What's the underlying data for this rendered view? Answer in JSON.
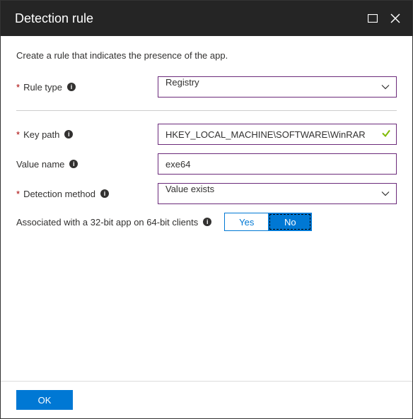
{
  "header": {
    "title": "Detection rule"
  },
  "description": "Create a rule that indicates the presence of the app.",
  "fields": {
    "ruleType": {
      "label": "Rule type",
      "value": "Registry"
    },
    "keyPath": {
      "label": "Key path",
      "value": "HKEY_LOCAL_MACHINE\\SOFTWARE\\WinRAR"
    },
    "valueName": {
      "label": "Value name",
      "value": "exe64"
    },
    "detectionMethod": {
      "label": "Detection method",
      "value": "Value exists"
    }
  },
  "toggle": {
    "label": "Associated with a 32-bit app on 64-bit clients",
    "yes": "Yes",
    "no": "No"
  },
  "footer": {
    "ok": "OK"
  }
}
